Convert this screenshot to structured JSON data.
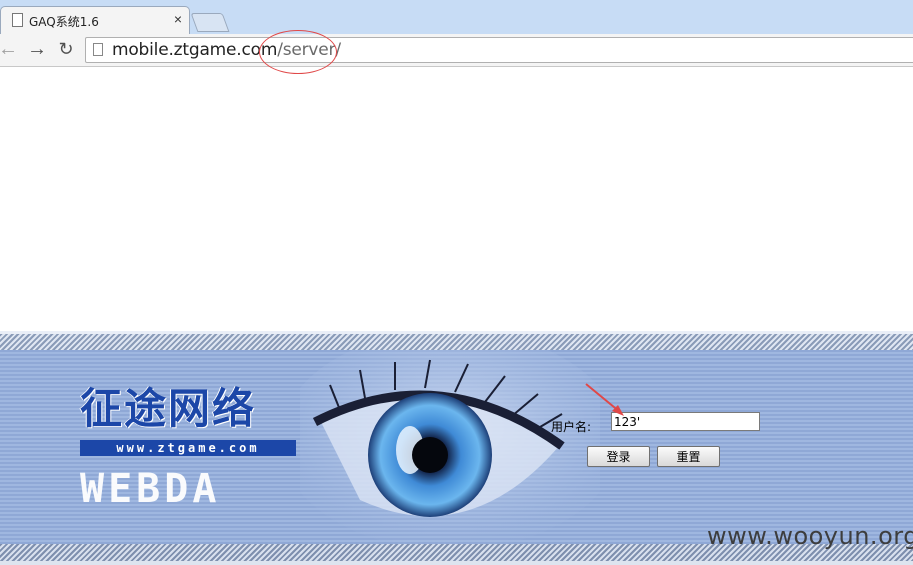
{
  "browser": {
    "tab": {
      "title": "GAQ系统1.6",
      "close_label": "×"
    },
    "url": {
      "host": "mobile.ztgame.com",
      "path": "/server/"
    },
    "nav": {
      "back": "←",
      "forward": "→",
      "reload": "↻"
    }
  },
  "login": {
    "logo_chinese": "征途网络",
    "logo_url": "www.ztgame.com",
    "logo_product": "WEBDA",
    "username_label": "用户名:",
    "username_value": "123'",
    "login_button": "登录",
    "reset_button": "重置"
  },
  "watermark": "www.wooyun.org",
  "colors": {
    "tab_strip": "#c7dcf5",
    "banner_blue": "#9fb7e0",
    "logo_blue": "#1c47a8",
    "annotation_red": "#e04848"
  }
}
